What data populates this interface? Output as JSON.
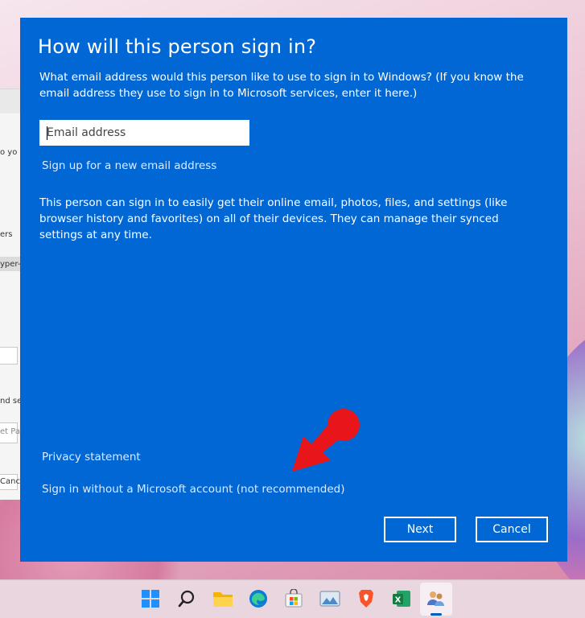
{
  "dialog": {
    "title": "How will this person sign in?",
    "description": "What email address would this person like to use to sign in to Windows? (If you know the email address they use to sign in to Microsoft services, enter it here.)",
    "email_placeholder": "Email address",
    "email_value": "",
    "signup_link": "Sign up for a new email address",
    "info_text": "This person can sign in to easily get their online email, photos, files, and settings (like browser history and favorites) on all of their devices. They can manage their synced settings at any time.",
    "privacy_link": "Privacy statement",
    "no_account_link": "Sign in without a Microsoft account (not recommended)",
    "next_label": "Next",
    "cancel_label": "Cancel",
    "accent_color": "#0067d5"
  },
  "background_window": {
    "fragments": [
      "o yo",
      "ers",
      "yper-",
      "nd se",
      "et Pa",
      "Cance"
    ]
  },
  "annotation": {
    "type": "arrow",
    "color": "#e8151a"
  },
  "taskbar": {
    "icons": [
      "windows-start-icon",
      "search-icon",
      "file-explorer-icon",
      "edge-browser-icon",
      "microsoft-store-icon",
      "photos-icon",
      "brave-browser-icon",
      "excel-icon",
      "user-accounts-icon"
    ],
    "active_icon": "user-accounts-icon"
  }
}
